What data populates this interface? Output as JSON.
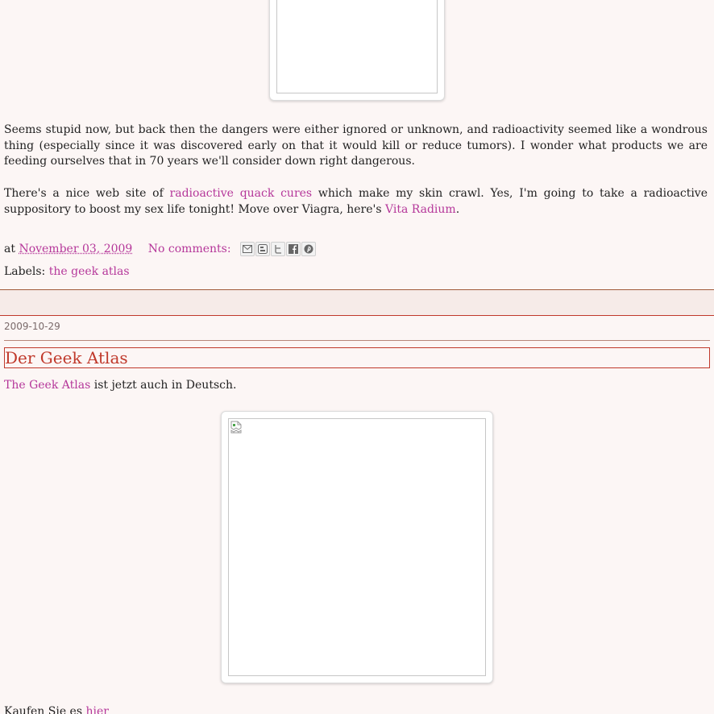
{
  "post1": {
    "paragraph1": "Seems stupid now, but back then the dangers were either ignored or unknown, and radioactivity seemed like a wondrous thing (especially since it was discovered early on that it would kill or reduce tumors). I wonder what products we are feeding ourselves that in 70 years we'll consider down right dangerous.",
    "paragraph2_before": "There's a nice web site of ",
    "paragraph2_link1": "radioactive quack cures",
    "paragraph2_middle": " which make my skin crawl. Yes, I'm going to take a radioactive suppository to boost my sex life tonight! Move over Viagra, here's ",
    "paragraph2_link2": "Vita Radium",
    "paragraph2_end": ".",
    "footer": {
      "at_label": "at",
      "timestamp": "November 03, 2009",
      "comments": "No comments:",
      "labels_prefix": "Labels:",
      "label_link": "the geek atlas"
    },
    "share_icons": [
      "email-icon",
      "blogger-icon",
      "twitter-icon",
      "facebook-icon",
      "pinterest-icon"
    ]
  },
  "post2": {
    "date": "2009-10-29",
    "title": "Der Geek Atlas",
    "intro_link": "The Geek Atlas",
    "intro_rest": " ist jetzt auch in Deutsch.",
    "bottom_text": "Kaufen Sie es ",
    "bottom_link": "hier"
  },
  "colors": {
    "background": "#fcf6f5",
    "link": "#b5379a",
    "title": "#c0392b",
    "separator": "#a15a3a"
  }
}
